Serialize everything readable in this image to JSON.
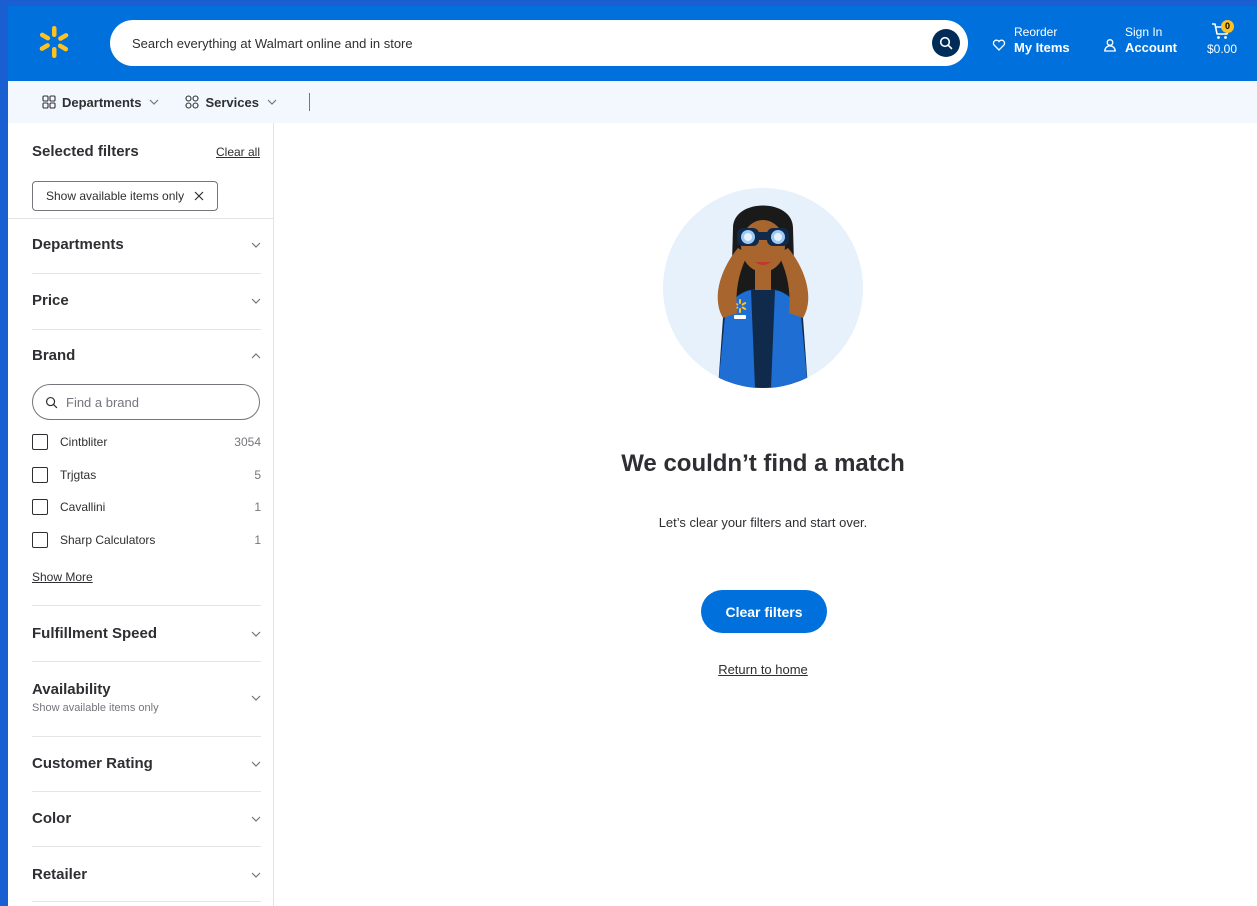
{
  "header": {
    "search_placeholder": "Search everything at Walmart online and in store",
    "reorder_label": "Reorder",
    "reorder_sub": "My Items",
    "signin_label": "Sign In",
    "signin_sub": "Account",
    "cart_count": "0",
    "cart_total": "$0.00",
    "logo_icon": "walmart-spark-icon",
    "brand_color": "#0071dc",
    "accent_color": "#ffc220"
  },
  "subnav": {
    "departments": "Departments",
    "services": "Services"
  },
  "sidebar": {
    "selected_filters_title": "Selected filters",
    "clear_all": "Clear all",
    "active_chip": "Show available items only",
    "facets": {
      "departments": "Departments",
      "price": "Price",
      "brand": "Brand",
      "fulfillment": "Fulfillment Speed",
      "availability": "Availability",
      "availability_sub": "Show available items only",
      "rating": "Customer Rating",
      "color": "Color",
      "retailer": "Retailer"
    },
    "brand_search_placeholder": "Find a brand",
    "brands": [
      {
        "name": "Cintbliter",
        "count": "3054"
      },
      {
        "name": "Trjgtas",
        "count": "5"
      },
      {
        "name": "Cavallini",
        "count": "1"
      },
      {
        "name": "Sharp Calculators",
        "count": "1"
      }
    ],
    "show_more": "Show More"
  },
  "main": {
    "title": "We couldn’t find a match",
    "subtitle": "Let’s clear your filters and start over.",
    "clear_button": "Clear filters",
    "return_home": "Return to home"
  }
}
